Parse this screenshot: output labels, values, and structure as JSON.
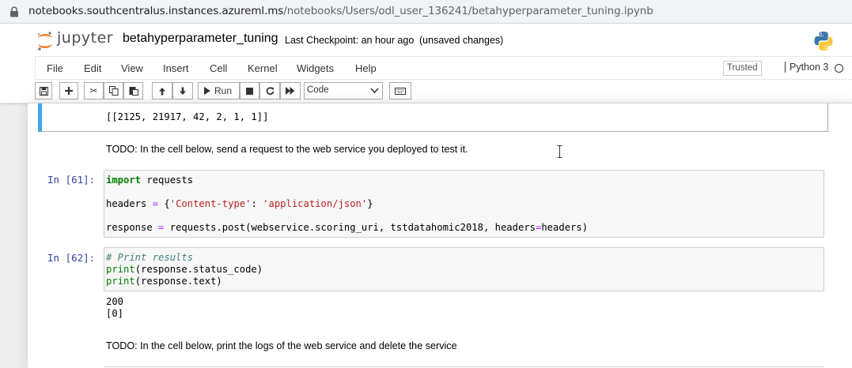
{
  "browser": {
    "url_host": "notebooks.southcentralus.instances.azureml.ms",
    "url_path": "/notebooks/Users/odl_user_136241/betahyperparameter_tuning.ipynb"
  },
  "header": {
    "logo_text": "jupyter",
    "notebook_name": "betahyperparameter_tuning",
    "checkpoint": "Last Checkpoint: an hour ago",
    "save_status": "(unsaved changes)"
  },
  "menubar": {
    "items": [
      "File",
      "Edit",
      "View",
      "Insert",
      "Cell",
      "Kernel",
      "Widgets",
      "Help"
    ],
    "trusted": "Trusted",
    "kernel": "Python 3"
  },
  "toolbar": {
    "run_label": "Run",
    "cell_type": "Code"
  },
  "cells": {
    "prev_output": "[[2125, 21917, 42, 2, 1, 1]]",
    "md1": "TODO: In the cell below, send a request to the web service you deployed to test it.",
    "c61": {
      "prompt": "In [61]:",
      "l1_kw": "import",
      "l1_rest": " requests",
      "l2_a": "headers ",
      "l2_op": "=",
      "l2_b": " {",
      "l2_s1": "'Content-type'",
      "l2_c": ": ",
      "l2_s2": "'application/json'",
      "l2_d": "}",
      "l3_a": "response ",
      "l3_op": "=",
      "l3_b": " requests.post(webservice.scoring_uri, tstdatahomic2018, headers",
      "l3_op2": "=",
      "l3_c": "headers)"
    },
    "c62": {
      "prompt": "In [62]:",
      "comment": "# Print results",
      "l2_fn": "print",
      "l2_rest": "(response.status_code)",
      "l3_fn": "print",
      "l3_rest": "(response.text)",
      "out1": "200",
      "out2": "[0]"
    },
    "md2": "TODO: In the cell below, print the logs of the web service and delete the service"
  }
}
